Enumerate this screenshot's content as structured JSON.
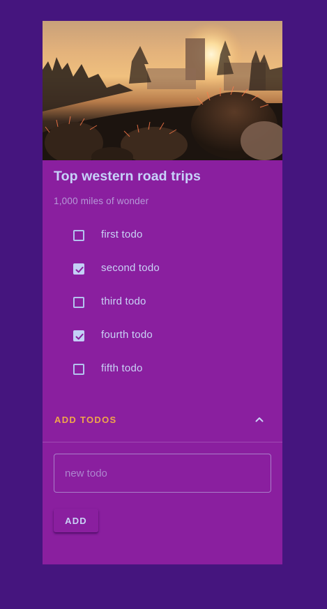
{
  "card": {
    "title": "Top western road trips",
    "subtitle": "1,000 miles of wonder"
  },
  "media": {
    "icon": "sunset-cactus-photo"
  },
  "todos": [
    {
      "label": "first todo",
      "checked": false
    },
    {
      "label": "second todo",
      "checked": true
    },
    {
      "label": "third todo",
      "checked": false
    },
    {
      "label": "fourth todo",
      "checked": true
    },
    {
      "label": "fifth todo",
      "checked": false
    }
  ],
  "expander": {
    "title": "ADD TODOS",
    "icon": "chevron-up-icon",
    "expanded": true
  },
  "form": {
    "placeholder": "new todo",
    "value": "",
    "button_label": "ADD"
  },
  "colors": {
    "background": "#45157e",
    "card": "#8a1f9f",
    "accent": "#f0a64a",
    "text": "#c9d3f6"
  }
}
